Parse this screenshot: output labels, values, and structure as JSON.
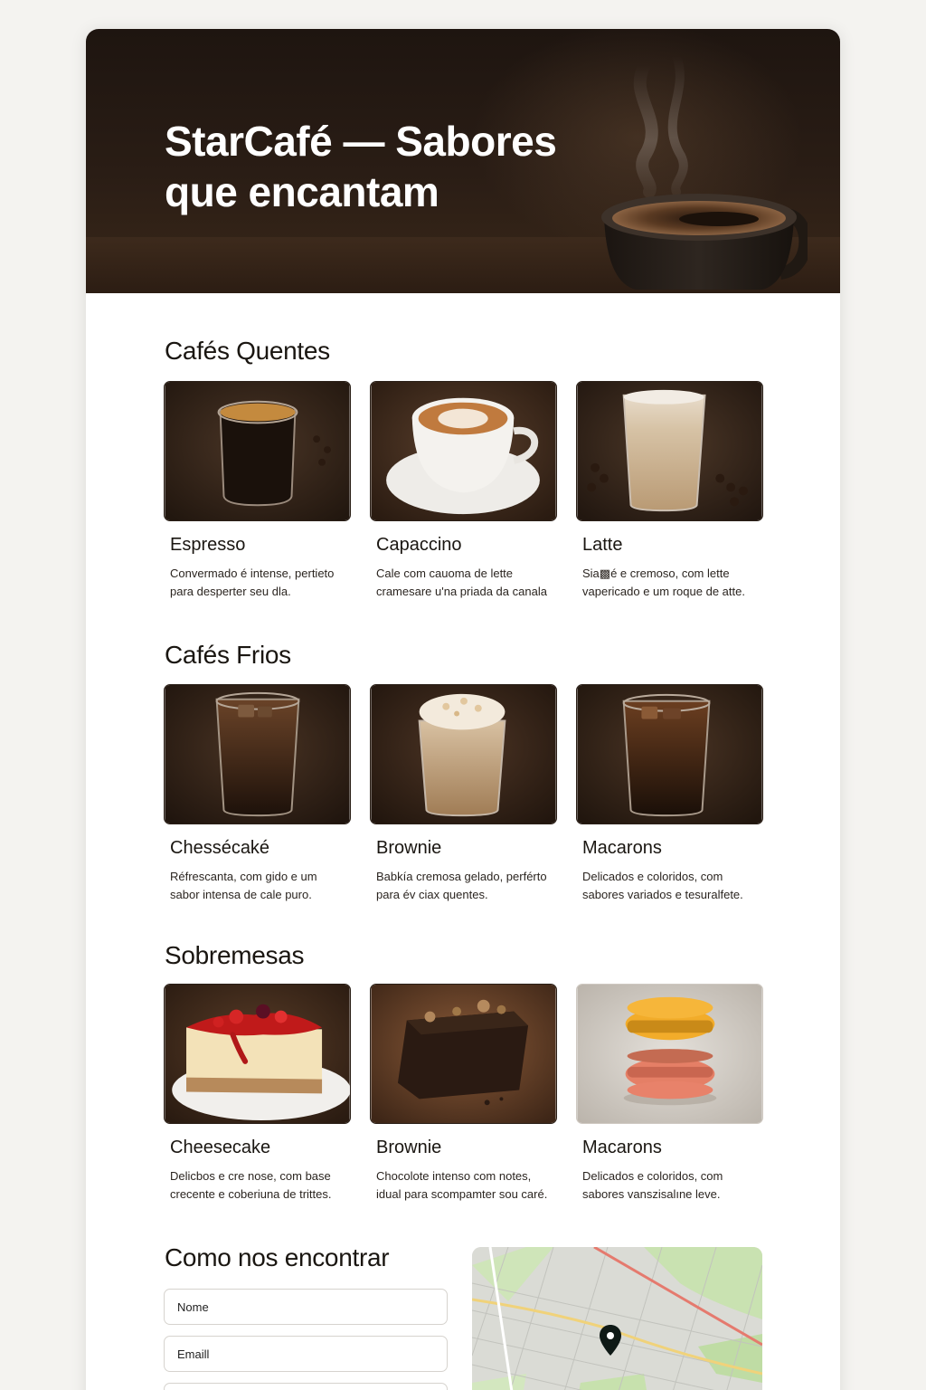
{
  "hero": {
    "title": "StarCafé — Sabores que encantam"
  },
  "sections": [
    {
      "title": "Cafés Quentes",
      "items": [
        {
          "name": "Espresso",
          "desc": "Convermado é intense, pertieto para desperter seu dla."
        },
        {
          "name": "Capaccino",
          "desc": "Cale com cauoma de lette cramesare u'na priada da canala"
        },
        {
          "name": "Latte",
          "desc": "Sia▩é e cremoso, com lette vapericado e um roque de atte."
        }
      ]
    },
    {
      "title": "Cafés Frios",
      "items": [
        {
          "name": "Chessécaké",
          "desc": "Réfrescanta, com gido e um sabor intensa de cale puro."
        },
        {
          "name": "Brownie",
          "desc": "Babkía cremosa gelado, perférto para év ciax quentes."
        },
        {
          "name": "Macarons",
          "desc": "Delicados e coloridos, com sabores variados e tesuralfete."
        }
      ]
    },
    {
      "title": "Sobremesas",
      "items": [
        {
          "name": "Cheesecake",
          "desc": "Delicbos e cre nose, com base crecente e coberiuna de trittes."
        },
        {
          "name": "Brownie",
          "desc": "Chocolote intenso com notes, idual para scompamter sou caré."
        },
        {
          "name": "Macarons",
          "desc": "Delicados e coloridos, com sabores vanszisalıne leve."
        }
      ]
    }
  ],
  "contact": {
    "title": "Como nos encontrar",
    "name_placeholder": "Nome",
    "email_placeholder": "Emaill"
  },
  "colors": {
    "hero_bg": "#221811",
    "coffee_bg": "#3a2a1f",
    "map_pin": "#0f1a16"
  }
}
